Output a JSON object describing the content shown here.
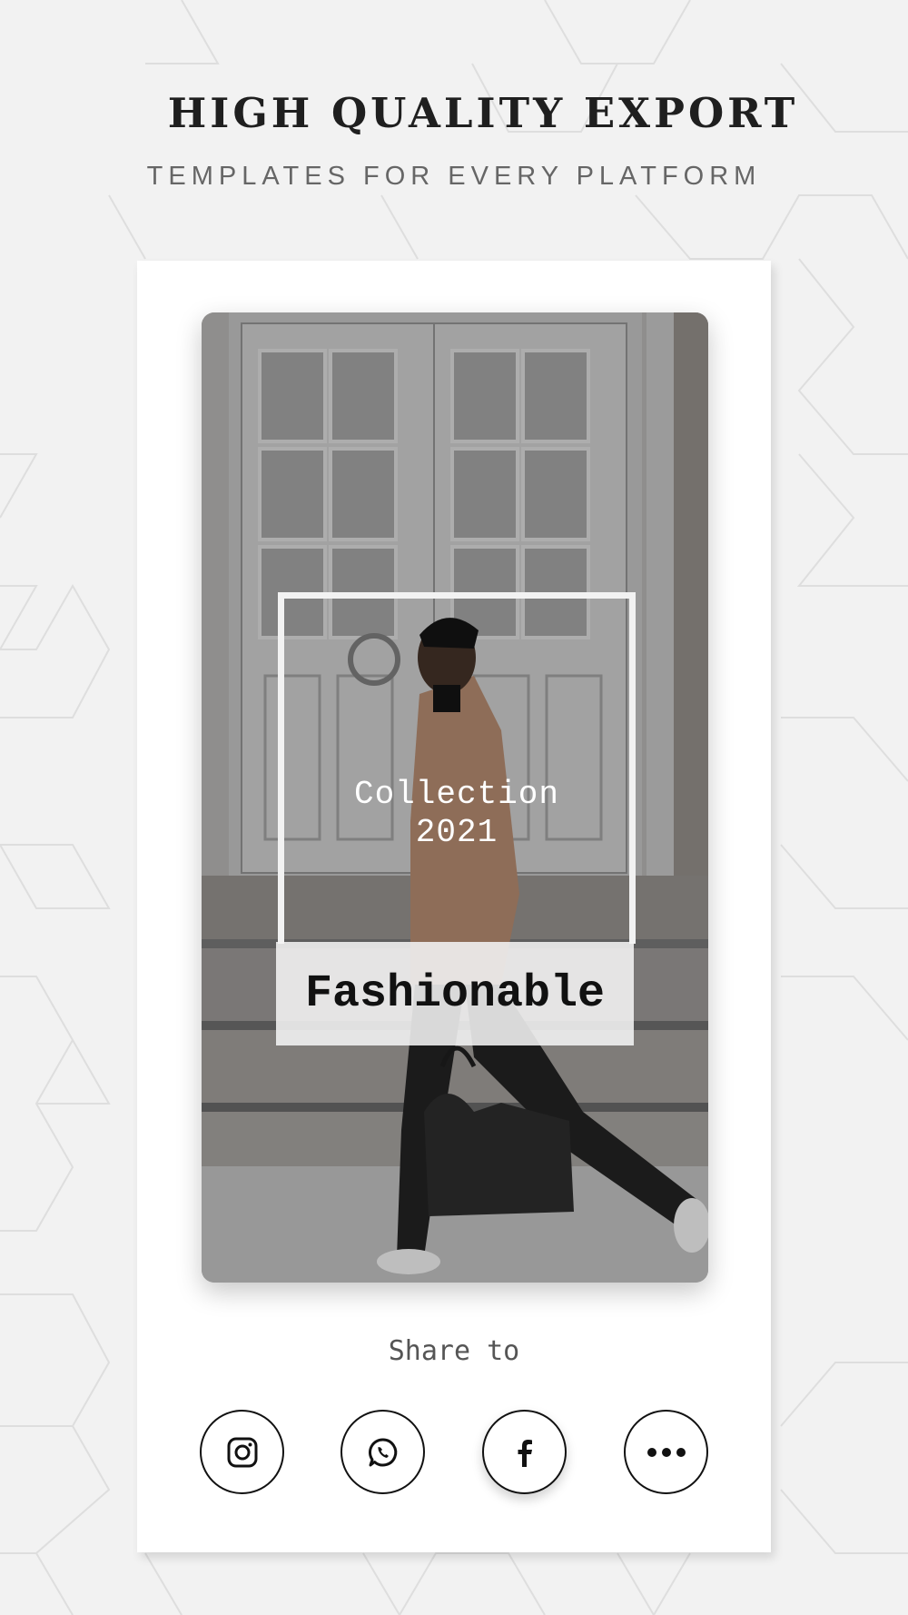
{
  "header": {
    "title": "HIGH QUALITY EXPORT",
    "subtitle": "TEMPLATES FOR EVERY PLATFORM"
  },
  "preview": {
    "collection_line1": "Collection",
    "collection_line2": "2021",
    "brand": "Fashionable"
  },
  "share": {
    "label": "Share to",
    "buttons": [
      {
        "name": "instagram",
        "icon": "instagram-icon"
      },
      {
        "name": "whatsapp",
        "icon": "whatsapp-icon"
      },
      {
        "name": "facebook",
        "icon": "facebook-icon"
      },
      {
        "name": "more",
        "icon": "more-icon"
      }
    ]
  },
  "colors": {
    "background": "#f2f2f2",
    "card": "#ffffff",
    "accent_dark": "#111111"
  }
}
